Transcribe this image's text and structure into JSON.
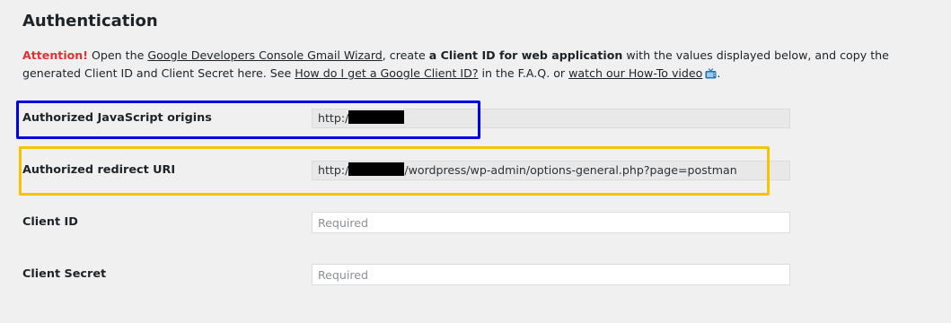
{
  "section": {
    "title": "Authentication"
  },
  "description": {
    "attention": "Attention!",
    "text_1": " Open the ",
    "link_console": "Google Developers Console Gmail Wizard",
    "text_2": ", create ",
    "strong_client": "a Client ID for web application",
    "text_3": " with the values displayed below, and copy the generated Client ID and Client Secret here. See ",
    "link_faq_question": "How do I get a Google Client ID?",
    "text_4": " in the F.A.Q. or ",
    "link_video": "watch our How-To video",
    "text_5": "."
  },
  "fields": {
    "js_origins": {
      "label": "Authorized JavaScript origins",
      "value_prefix": "http:/"
    },
    "redirect_uri": {
      "label": "Authorized redirect URI",
      "value_prefix": "http:/",
      "value_suffix": "/wordpress/wp-admin/options-general.php?page=postman"
    },
    "client_id": {
      "label": "Client ID",
      "value": "",
      "placeholder": "Required"
    },
    "client_secret": {
      "label": "Client Secret",
      "value": "",
      "placeholder": "Required"
    }
  },
  "icons": {
    "video": "tv-icon"
  },
  "colors": {
    "attention": "#dc3232",
    "highlight_blue": "#0000e6",
    "highlight_yellow": "#f5c400",
    "background": "#f0f0f1"
  }
}
